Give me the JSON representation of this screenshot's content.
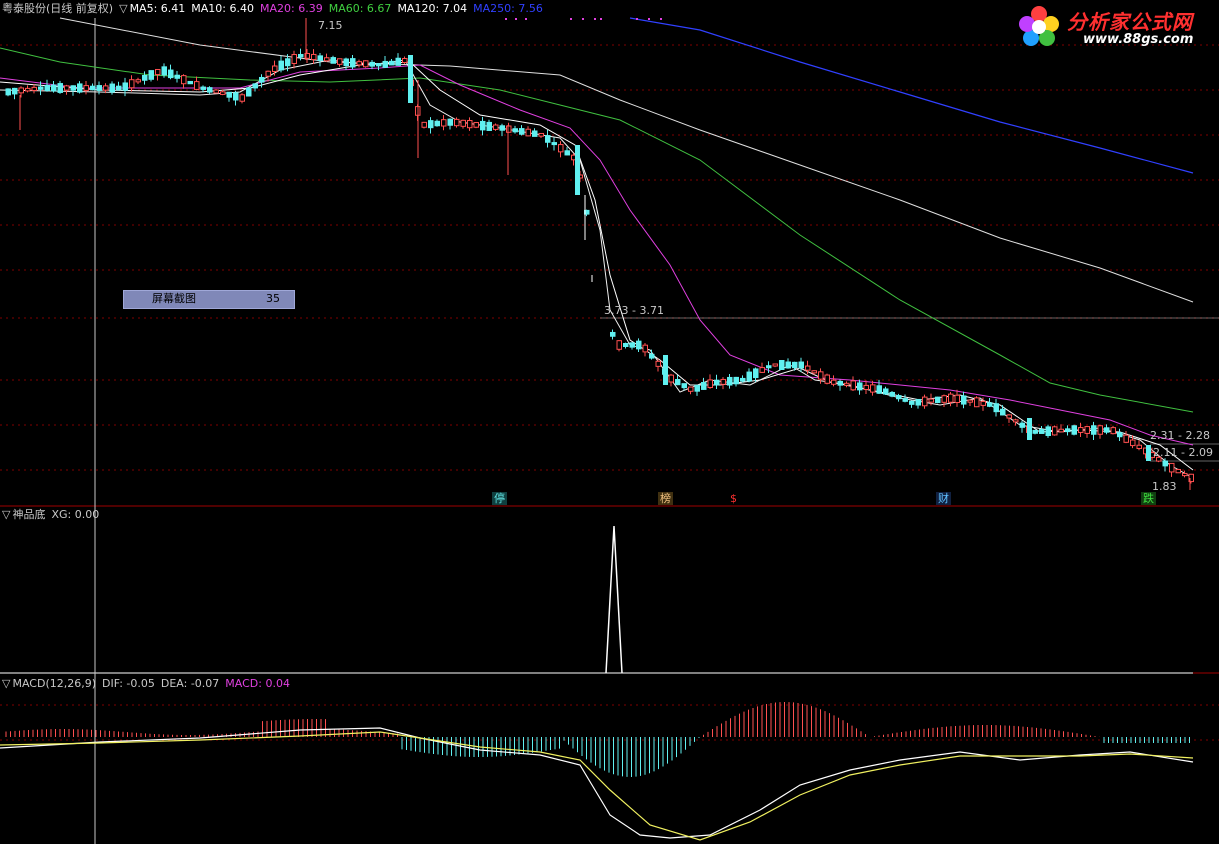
{
  "header": {
    "stock": "粤泰股份(日线 前复权)",
    "ma_arrow": "▽",
    "ma5": "MA5: 6.41",
    "ma10": "MA10: 6.40",
    "ma20": "MA20: 6.39",
    "ma60": "MA60: 6.67",
    "ma120": "MA120: 7.04",
    "ma250": "MA250: 7.56",
    "colors": {
      "ma5": "#ffffff",
      "ma10": "#ffffff",
      "ma20": "#e040e0",
      "ma60": "#40d040",
      "ma120": "#ffffff",
      "ma250": "#3040ff"
    }
  },
  "logo": {
    "title": "分析家公式网",
    "url": "www.88gs.com",
    "icon": "flower-icon"
  },
  "price_labels": {
    "high": "7.15",
    "range1": "3.73 - 3.71",
    "range2": "2.31 - 2.28",
    "range3": "2.11 - 2.09",
    "low": "1.83"
  },
  "screenshot_box": {
    "label": "屏幕截图",
    "value": "35"
  },
  "markers": [
    {
      "text": "停",
      "color": "#60e0e0"
    },
    {
      "text": "榜",
      "color": "#f0c080"
    },
    {
      "text": "$",
      "color": "#ff3030"
    },
    {
      "text": "财",
      "color": "#60c0ff"
    },
    {
      "text": "跌",
      "color": "#40e040"
    }
  ],
  "indicator1": {
    "arrow": "▽",
    "name": "神品底",
    "xg": "XG: 0.00"
  },
  "indicator2": {
    "arrow": "▽",
    "name": "MACD(12,26,9)",
    "dif": "DIF: -0.05",
    "dea": "DEA: -0.07",
    "macd": "MACD: 0.04",
    "macd_color": "#e040e0"
  }
}
